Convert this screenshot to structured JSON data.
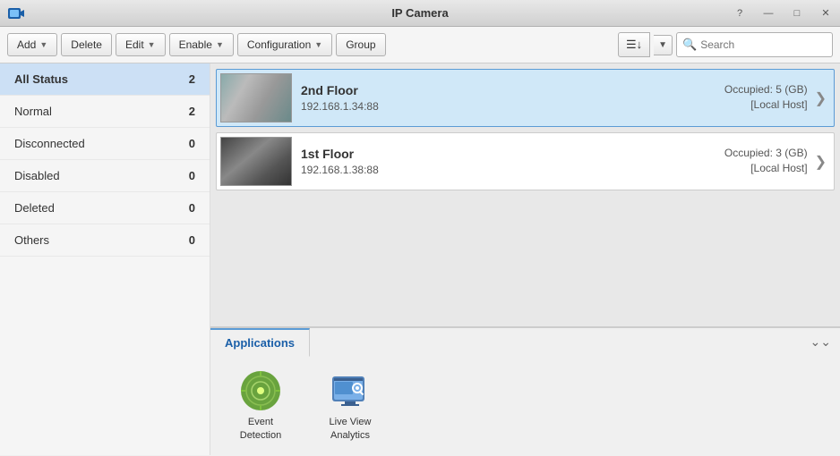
{
  "titleBar": {
    "title": "IP Camera",
    "icon": "camera-icon",
    "controls": {
      "help": "?",
      "minimize": "—",
      "maximize": "□",
      "close": "✕"
    }
  },
  "toolbar": {
    "add": "Add",
    "delete": "Delete",
    "edit": "Edit",
    "enable": "Enable",
    "configuration": "Configuration",
    "group": "Group",
    "search_placeholder": "Search"
  },
  "sidebar": {
    "items": [
      {
        "label": "All Status",
        "count": "2",
        "active": true
      },
      {
        "label": "Normal",
        "count": "2",
        "active": false
      },
      {
        "label": "Disconnected",
        "count": "0",
        "active": false
      },
      {
        "label": "Disabled",
        "count": "0",
        "active": false
      },
      {
        "label": "Deleted",
        "count": "0",
        "active": false
      },
      {
        "label": "Others",
        "count": "0",
        "active": false
      }
    ]
  },
  "cameras": [
    {
      "name": "2nd Floor",
      "ip": "192.168.1.34:88",
      "occupied": "Occupied: 5 (GB)",
      "host": "[Local Host]",
      "selected": true
    },
    {
      "name": "1st Floor",
      "ip": "192.168.1.38:88",
      "occupied": "Occupied: 3 (GB)",
      "host": "[Local Host]",
      "selected": false
    }
  ],
  "applications": {
    "tab_label": "Applications",
    "collapse_icon": "double-chevron-icon",
    "items": [
      {
        "label": "Event Detection",
        "icon": "event-detection-icon"
      },
      {
        "label": "Live View Analytics",
        "icon": "live-analytics-icon"
      }
    ]
  }
}
